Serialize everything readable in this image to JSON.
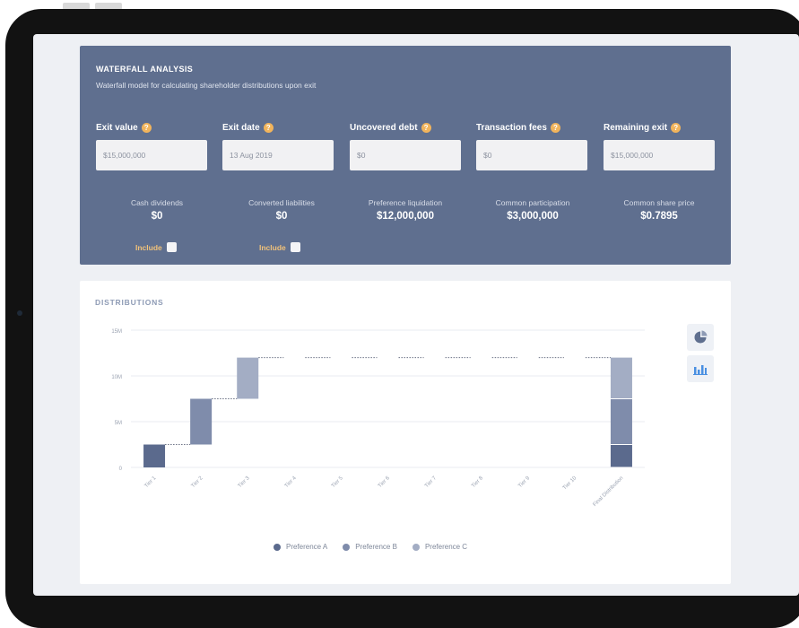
{
  "waterfall": {
    "title": "WATERFALL ANALYSIS",
    "subtitle": "Waterfall model for calculating shareholder distributions upon exit",
    "fields": [
      {
        "label": "Exit value",
        "value": "$15,000,000"
      },
      {
        "label": "Exit date",
        "value": "13 Aug 2019"
      },
      {
        "label": "Uncovered debt",
        "value": "$0"
      },
      {
        "label": "Transaction fees",
        "value": "$0"
      },
      {
        "label": "Remaining exit",
        "value": "$15,000,000"
      }
    ],
    "help_icon_glyph": "?",
    "stats": [
      {
        "label": "Cash dividends",
        "value": "$0"
      },
      {
        "label": "Converted liabilities",
        "value": "$0"
      },
      {
        "label": "Preference liquidation",
        "value": "$12,000,000"
      },
      {
        "label": "Common participation",
        "value": "$3,000,000"
      },
      {
        "label": "Common share price",
        "value": "$0.7895"
      }
    ],
    "include_label": "Include"
  },
  "distributions": {
    "title": "DISTRIBUTIONS",
    "icons": [
      "pie-chart-icon",
      "bar-chart-icon"
    ]
  },
  "colors": {
    "card_blue": "#5f6f8f",
    "accent_orange": "#f1b45c",
    "series_a": "#5b6a8d",
    "series_b": "#7f8cab",
    "series_c": "#a3adc4"
  },
  "chart_data": {
    "type": "bar",
    "categories": [
      "Tier 1",
      "Tier 2",
      "Tier 3",
      "Tier 4",
      "Tier 5",
      "Tier 6",
      "Tier 7",
      "Tier 8",
      "Tier 9",
      "Tier 10",
      "Final Distribution"
    ],
    "y_tick_labels": [
      "0",
      "5M",
      "10M",
      "15M"
    ],
    "ylim": [
      0,
      15000000
    ],
    "grid": true,
    "legend_position": "bottom",
    "series": [
      {
        "name": "Preference A",
        "color": "#5b6a8d",
        "values": [
          2500000,
          0,
          0,
          0,
          0,
          0,
          0,
          0,
          0,
          0,
          2500000
        ]
      },
      {
        "name": "Preference B",
        "color": "#7f8cab",
        "values": [
          0,
          5000000,
          0,
          0,
          0,
          0,
          0,
          0,
          0,
          0,
          5000000
        ]
      },
      {
        "name": "Preference C",
        "color": "#a3adc4",
        "values": [
          0,
          0,
          4500000,
          0,
          0,
          0,
          0,
          0,
          0,
          0,
          4500000
        ]
      }
    ]
  }
}
